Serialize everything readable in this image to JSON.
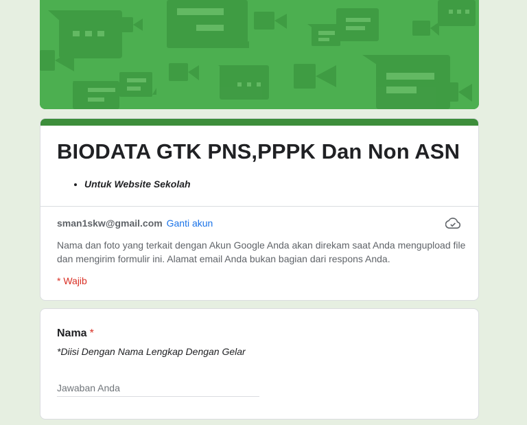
{
  "form": {
    "title": "BIODATA GTK PNS,PPPK Dan Non ASN",
    "description_item": "Untuk Website Sekolah",
    "account_email": "sman1skw@gmail.com",
    "switch_account": "Ganti akun",
    "notice": "Nama dan foto yang terkait dengan Akun Google Anda akan direkam saat Anda mengupload file dan mengirim formulir ini. Alamat email Anda bukan bagian dari respons Anda.",
    "required_note": "* Wajib"
  },
  "questions": [
    {
      "title": "Nama",
      "required_mark": "*",
      "help": "*Diisi Dengan Nama Lengkap Dengan Gelar",
      "placeholder": "Jawaban Anda"
    }
  ],
  "colors": {
    "banner": "#4caf50",
    "accent": "#3d8e3b",
    "link": "#1a73e8",
    "required": "#d93025",
    "background": "#e6efe1"
  },
  "icons": {
    "cloud": "cloud-check-icon"
  }
}
